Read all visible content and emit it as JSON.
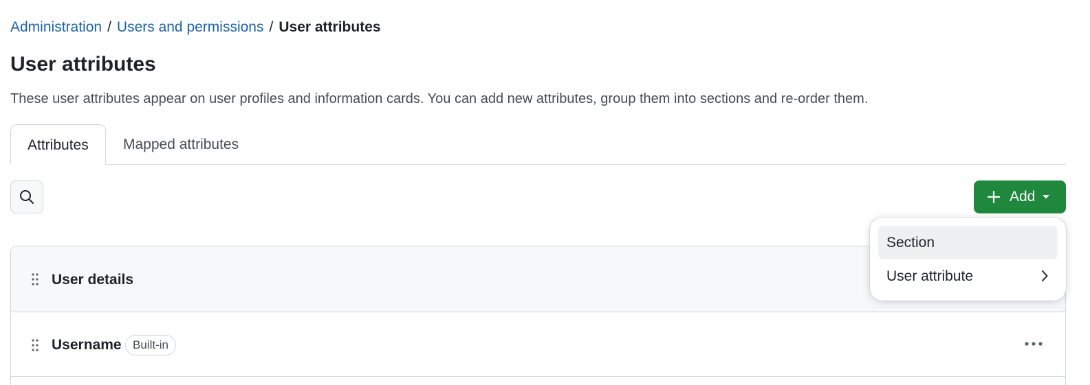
{
  "breadcrumb": {
    "items": [
      "Administration",
      "Users and permissions"
    ],
    "separator": "/",
    "current": "User attributes"
  },
  "page": {
    "title": "User attributes",
    "description": "These user attributes appear on user profiles and information cards. You can add new attributes, group them into sections and re-order them."
  },
  "tabs": [
    {
      "label": "Attributes",
      "active": true
    },
    {
      "label": "Mapped attributes",
      "active": false
    }
  ],
  "toolbar": {
    "search_icon": "search-icon",
    "add_label": "Add"
  },
  "table": {
    "section": {
      "label": "User details"
    },
    "rows": [
      {
        "label": "Username",
        "badge": "Built-in"
      }
    ]
  },
  "add_menu": {
    "items": [
      {
        "label": "Section",
        "highlighted": true
      },
      {
        "label": "User attribute",
        "has_submenu": true
      }
    ]
  },
  "colors": {
    "link": "#1b62a8",
    "primary_button": "#1f883d",
    "border": "#d0d7de",
    "section_bg": "#f6f8fa"
  }
}
